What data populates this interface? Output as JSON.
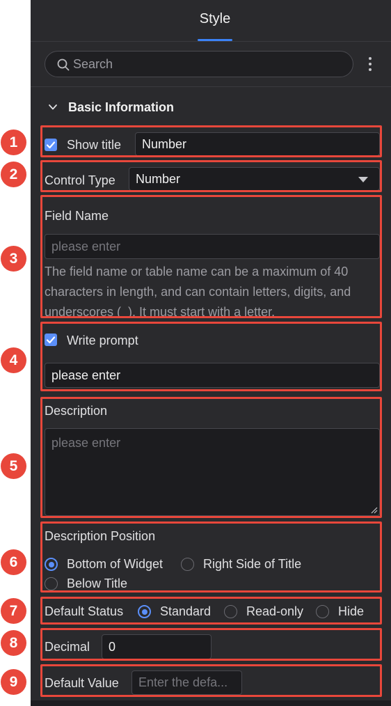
{
  "tab": {
    "label": "Style"
  },
  "search": {
    "placeholder": "Search"
  },
  "section": {
    "title": "Basic Information"
  },
  "show_title": {
    "label": "Show title",
    "checked": true,
    "value": "Number"
  },
  "control_type": {
    "label": "Control Type",
    "value": "Number"
  },
  "field_name": {
    "label": "Field Name",
    "placeholder": "please enter",
    "help": "The field name or table name can be a maximum of 40 characters in length, and can contain letters, digits, and underscores (_). It must start with a letter."
  },
  "write_prompt": {
    "label": "Write prompt",
    "checked": true,
    "value": "please enter"
  },
  "description": {
    "label": "Description",
    "placeholder": "please enter"
  },
  "description_position": {
    "label": "Description Position",
    "selected": "Bottom of Widget",
    "options": [
      "Bottom of Widget",
      "Right Side of Title",
      "Below Title"
    ]
  },
  "default_status": {
    "label": "Default Status",
    "selected": "Standard",
    "options": [
      "Standard",
      "Read-only",
      "Hide"
    ]
  },
  "decimal": {
    "label": "Decimal",
    "value": "0"
  },
  "default_value": {
    "label": "Default Value",
    "placeholder": "Enter the defa..."
  },
  "badges": [
    "1",
    "2",
    "3",
    "4",
    "5",
    "6",
    "7",
    "8",
    "9"
  ],
  "colors": {
    "accent": "#5b8ff9",
    "highlight": "#e8473b",
    "panel": "#2a2a2d"
  }
}
